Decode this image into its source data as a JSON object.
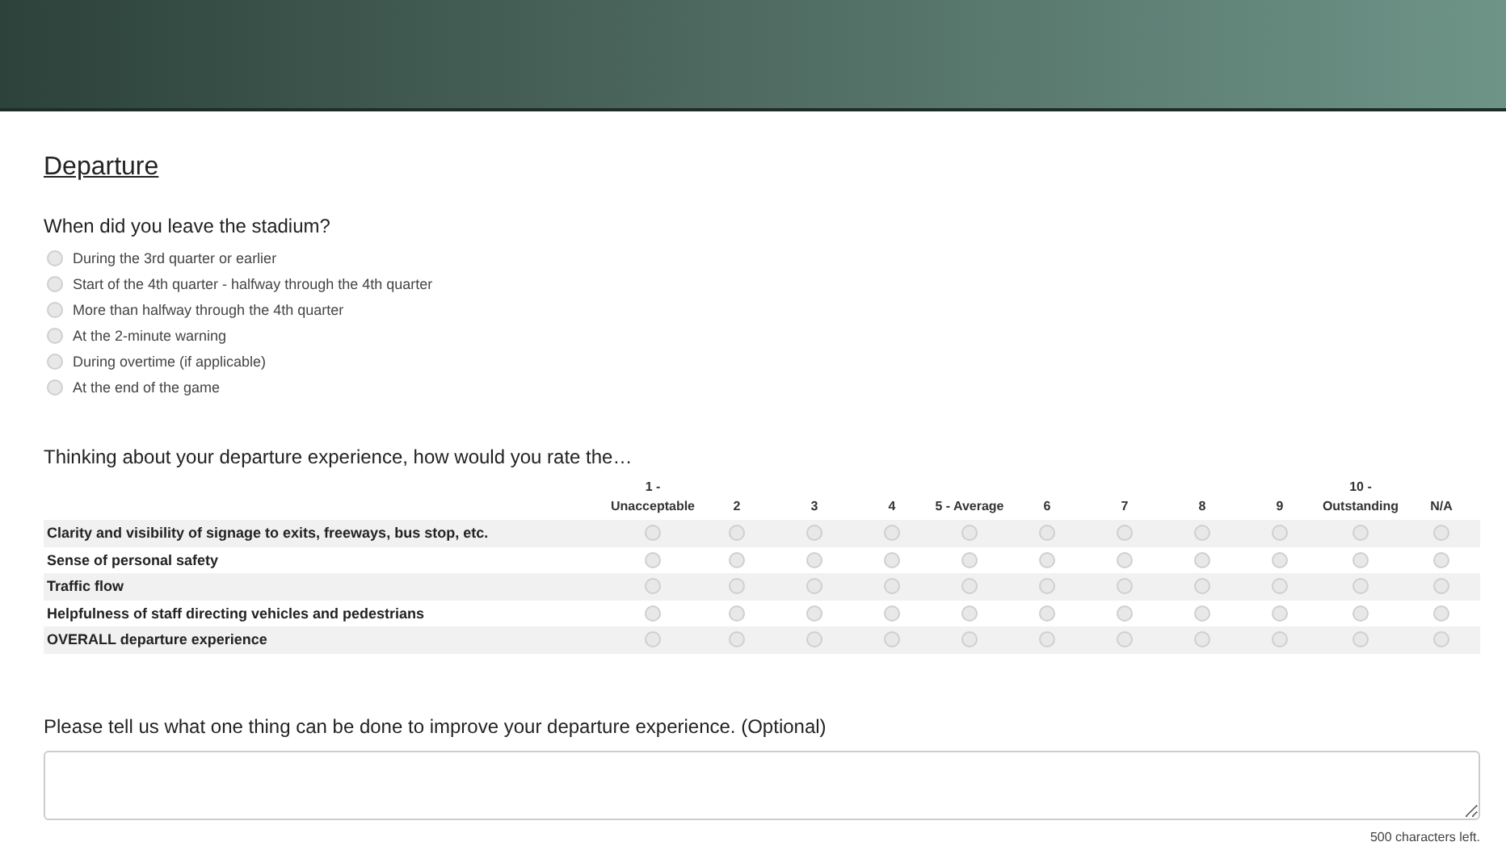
{
  "section_title": "Departure",
  "question_1": {
    "text": "When did you leave the stadium?",
    "options": [
      {
        "label": "During the 3rd quarter or earlier",
        "selected": false
      },
      {
        "label": "Start of the 4th quarter - halfway through the 4th quarter",
        "selected": false
      },
      {
        "label": "More than halfway through the 4th quarter",
        "selected": false
      },
      {
        "label": "At the 2-minute warning",
        "selected": false
      },
      {
        "label": "During overtime (if applicable)",
        "selected": false
      },
      {
        "label": "At the end of the game",
        "selected": false
      }
    ]
  },
  "question_2": {
    "text": "Thinking about your departure experience, how would you rate the…",
    "columns": [
      [
        "1 -",
        "Unacceptable"
      ],
      [
        "2"
      ],
      [
        "3"
      ],
      [
        "4"
      ],
      [
        "5 - Average"
      ],
      [
        "6"
      ],
      [
        "7"
      ],
      [
        "8"
      ],
      [
        "9"
      ],
      [
        "10 -",
        "Outstanding"
      ],
      [
        "N/A"
      ]
    ],
    "rows": [
      {
        "label": "Clarity and visibility of signage to exits, freeways, bus stop, etc.",
        "selected": [
          false,
          false,
          false,
          false,
          false,
          false,
          false,
          false,
          false,
          false,
          false
        ]
      },
      {
        "label": "Sense of personal safety",
        "selected": [
          false,
          false,
          false,
          false,
          false,
          false,
          false,
          false,
          false,
          false,
          false
        ]
      },
      {
        "label": "Traffic flow",
        "selected": [
          false,
          false,
          false,
          false,
          false,
          false,
          false,
          false,
          false,
          false,
          false
        ]
      },
      {
        "label": "Helpfulness of staff directing vehicles and pedestrians",
        "selected": [
          false,
          false,
          false,
          false,
          false,
          false,
          false,
          false,
          false,
          false,
          false
        ]
      },
      {
        "label": "OVERALL departure experience",
        "selected": [
          false,
          false,
          false,
          false,
          false,
          false,
          false,
          false,
          false,
          false,
          false
        ]
      }
    ]
  },
  "question_3": {
    "text": "Please tell us what one thing can be done to improve your departure experience. (Optional)",
    "counter": "500 characters left."
  }
}
